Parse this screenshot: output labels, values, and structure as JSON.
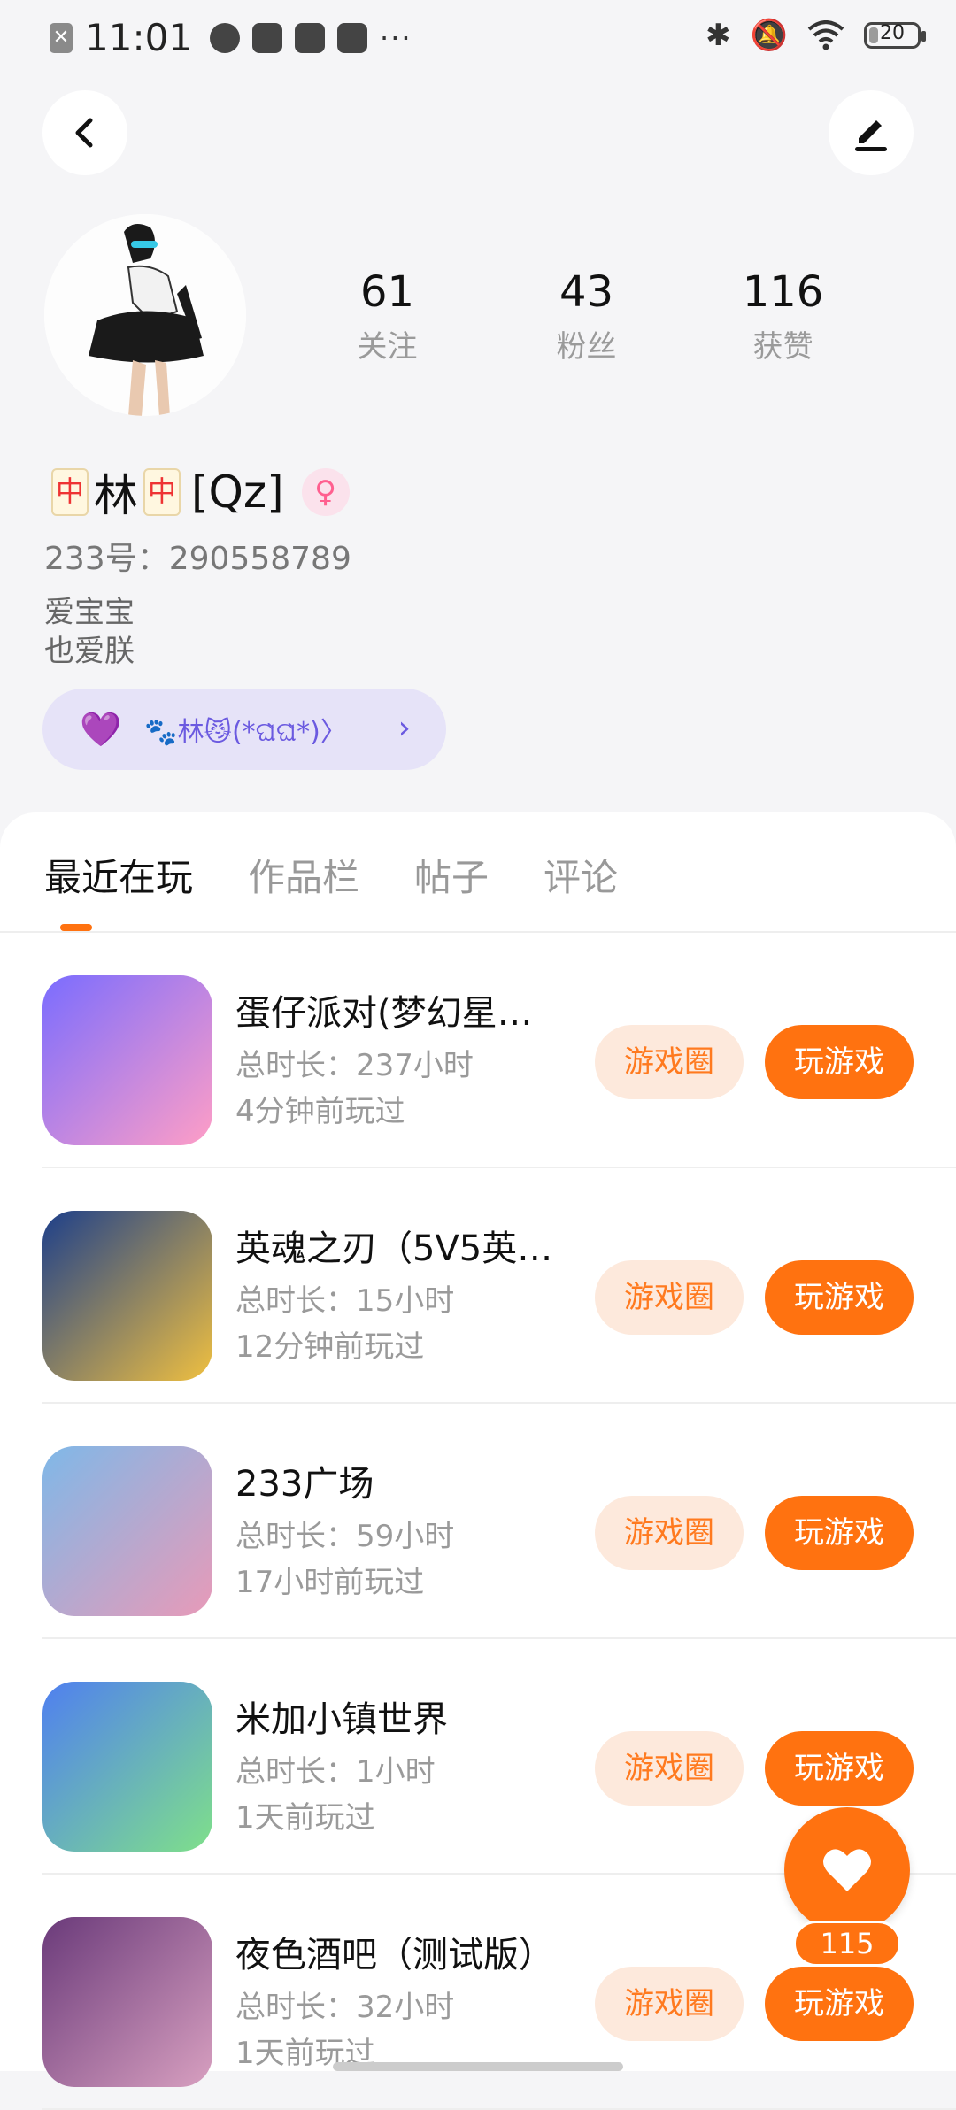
{
  "status_bar": {
    "time": "11:01",
    "battery": "20",
    "battery_level": 0.2
  },
  "profile": {
    "stats": [
      {
        "value": "61",
        "label": "关注"
      },
      {
        "value": "43",
        "label": "粉丝"
      },
      {
        "value": "116",
        "label": "获赞"
      }
    ],
    "nickname_mid": "林",
    "nickname_suffix": "[Qz]",
    "mahjong_tile": "中",
    "gender_symbol": "♀",
    "uid": "233号：290558789",
    "bio_line1": "爱宝宝",
    "bio_line2": "也爱朕",
    "tag_text": "🐾林😼(*ଘ̀ଘ̀*)〉"
  },
  "tabs": [
    {
      "label": "最近在玩",
      "active": true
    },
    {
      "label": "作品栏",
      "active": false
    },
    {
      "label": "帖子",
      "active": false
    },
    {
      "label": "评论",
      "active": false
    }
  ],
  "games": [
    {
      "name": "蛋仔派对(梦幻星…",
      "total": "总时长：237小时",
      "last": "4分钟前玩过",
      "circle_label": "游戏圈",
      "play_label": "玩游戏",
      "colors": [
        "#7a6cff",
        "#ff9ec6"
      ]
    },
    {
      "name": "英魂之刃（5V5英…",
      "total": "总时长：15小时",
      "last": "12分钟前玩过",
      "circle_label": "游戏圈",
      "play_label": "玩游戏",
      "colors": [
        "#1d3f8a",
        "#f0c040"
      ]
    },
    {
      "name": "233广场",
      "total": "总时长：59小时",
      "last": "17小时前玩过",
      "circle_label": "游戏圈",
      "play_label": "玩游戏",
      "colors": [
        "#7fb8e8",
        "#e89ab8"
      ]
    },
    {
      "name": "米加小镇世界",
      "total": "总时长：1小时",
      "last": "1天前玩过",
      "circle_label": "游戏圈",
      "play_label": "玩游戏",
      "colors": [
        "#4f7ff0",
        "#7fe08a"
      ]
    },
    {
      "name": "夜色酒吧（测试版）",
      "total": "总时长：32小时",
      "last": "1天前玩过",
      "circle_label": "游戏圈",
      "play_label": "玩游戏",
      "colors": [
        "#6a3a7a",
        "#d8a0c0"
      ]
    }
  ],
  "fab": {
    "count": "115"
  },
  "colors": {
    "accent": "#ff7210",
    "accent_light": "#fde9dc",
    "tag_purple": "#6b5ae0"
  }
}
